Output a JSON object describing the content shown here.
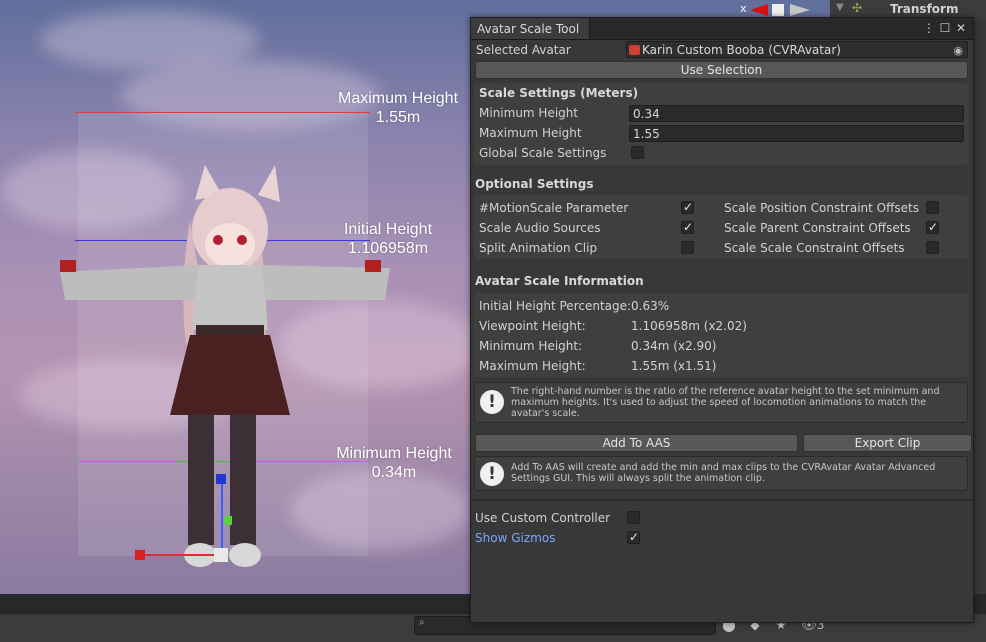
{
  "scene": {
    "max_label_line1": "Maximum Height",
    "max_label_line2": "1.55m",
    "init_label_line1": "Initial Height",
    "init_label_line2": "1.106958m",
    "min_label_line1": "Minimum Height",
    "min_label_line2": "0.34m",
    "axis_label": "x",
    "colors": {
      "max_line": "#d84040",
      "init_line": "#3c3cdc",
      "min_line": "#40c040"
    }
  },
  "inspector": {
    "tab_label": "Transform"
  },
  "bottom": {
    "counter": "3"
  },
  "tool": {
    "tab": "Avatar Scale Tool",
    "selected_avatar_label": "Selected Avatar",
    "selected_avatar_value": "Karin Custom Booba (CVRAvatar)",
    "use_selection": "Use Selection",
    "scale_settings": {
      "header": "Scale Settings (Meters)",
      "min_label": "Minimum Height",
      "min_value": "0.34",
      "max_label": "Maximum Height",
      "max_value": "1.55",
      "global_label": "Global Scale Settings",
      "global_checked": false
    },
    "optional": {
      "header": "Optional Settings",
      "left": [
        {
          "label": "#MotionScale Parameter",
          "checked": true
        },
        {
          "label": "Scale Audio Sources",
          "checked": true
        },
        {
          "label": "Split Animation Clip",
          "checked": false
        }
      ],
      "right": [
        {
          "label": "Scale Position Constraint Offsets",
          "checked": false
        },
        {
          "label": "Scale Parent Constraint Offsets",
          "checked": true
        },
        {
          "label": "Scale Scale Constraint Offsets",
          "checked": false
        }
      ]
    },
    "info": {
      "header": "Avatar Scale Information",
      "rows": [
        {
          "label": "Initial Height Percentage:",
          "value": "0.63%"
        },
        {
          "label": "Viewpoint Height:",
          "value": "1.106958m (x2.02)"
        },
        {
          "label": "Minimum Height:",
          "value": "0.34m (x2.90)"
        },
        {
          "label": "Maximum Height:",
          "value": "1.55m (x1.51)"
        }
      ],
      "help": "The right-hand number is the ratio of the reference avatar height to the set minimum and maximum heights. It's used to adjust the speed of locomotion animations to match the avatar's scale."
    },
    "add_to_aas": "Add To AAS",
    "export_clip": "Export Clip",
    "aas_help": "Add To AAS will create and add the min and max clips to the CVRAvatar Avatar Advanced Settings GUI. This will always split the animation clip.",
    "use_custom_controller": "Use Custom Controller",
    "use_custom_checked": false,
    "show_gizmos": "Show Gizmos",
    "show_gizmos_checked": true,
    "link_color": "#7da7ff"
  }
}
